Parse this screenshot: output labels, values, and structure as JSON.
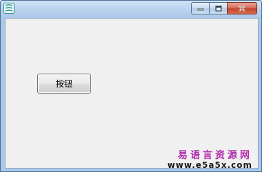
{
  "window": {
    "title": "",
    "controls": {
      "minimize_icon": "minimize-icon",
      "maximize_icon": "maximize-icon",
      "close_icon": "close-icon"
    }
  },
  "form": {
    "button_label": "按钮"
  },
  "watermark": {
    "site_name": "易语言资源网",
    "url": "www.e5a5x.com"
  },
  "colors": {
    "watermark_text": "#b12db0",
    "client_bg": "#f0f0f0",
    "close_button": "#c3442f"
  }
}
